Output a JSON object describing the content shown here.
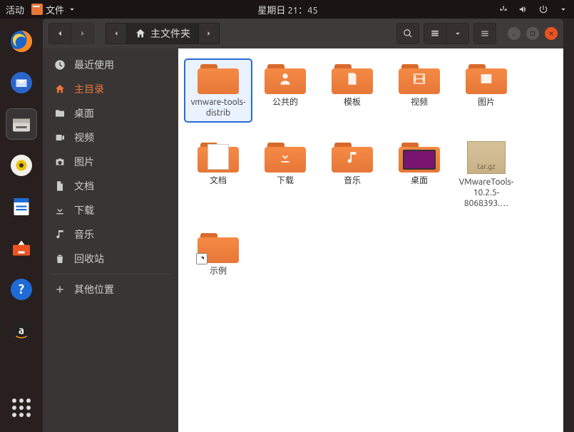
{
  "panel": {
    "activities": "活动",
    "app_menu": "文件",
    "clock": "星期日 21：45"
  },
  "window": {
    "path_label": "主文件夹"
  },
  "sidebar": {
    "items": [
      {
        "key": "recent",
        "label": "最近使用"
      },
      {
        "key": "home",
        "label": "主目录"
      },
      {
        "key": "desktop",
        "label": "桌面"
      },
      {
        "key": "videos",
        "label": "视频"
      },
      {
        "key": "pictures",
        "label": "图片"
      },
      {
        "key": "documents",
        "label": "文档"
      },
      {
        "key": "downloads",
        "label": "下载"
      },
      {
        "key": "music",
        "label": "音乐"
      },
      {
        "key": "trash",
        "label": "回收站"
      },
      {
        "key": "other",
        "label": "其他位置"
      }
    ]
  },
  "files": [
    {
      "name": "vmware-tools-distrib",
      "type": "folder",
      "selected": true
    },
    {
      "name": "公共的",
      "type": "folder",
      "emblem": "share"
    },
    {
      "name": "模板",
      "type": "folder",
      "emblem": "template"
    },
    {
      "name": "视频",
      "type": "folder",
      "emblem": "video"
    },
    {
      "name": "图片",
      "type": "folder",
      "emblem": "picture"
    },
    {
      "name": "文档",
      "type": "folder",
      "emblem": "doc"
    },
    {
      "name": "下载",
      "type": "folder",
      "emblem": "download"
    },
    {
      "name": "音乐",
      "type": "folder",
      "emblem": "music"
    },
    {
      "name": "桌面",
      "type": "folder",
      "emblem": "desktop"
    },
    {
      "name": "VMwareTools-10.2.5-8068393.…",
      "type": "targz"
    },
    {
      "name": "示例",
      "type": "folder",
      "link": true
    }
  ]
}
